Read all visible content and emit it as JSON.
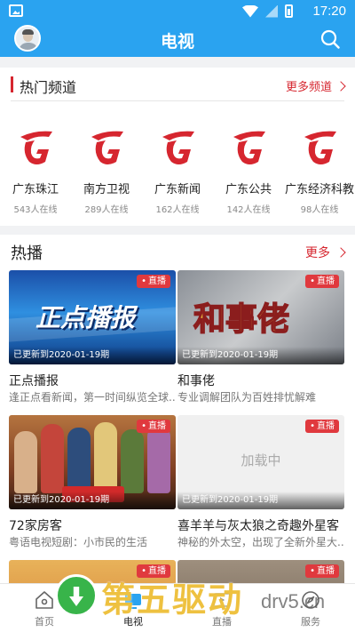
{
  "status_bar": {
    "time": "17:20",
    "battery_level": 0.5
  },
  "header": {
    "title": "电视"
  },
  "hot_channels": {
    "title": "热门频道",
    "more_label": "更多频道",
    "channels": [
      {
        "name": "广东珠江",
        "viewers": "543人在线"
      },
      {
        "name": "南方卫视",
        "viewers": "289人在线"
      },
      {
        "name": "广东新闻",
        "viewers": "162人在线"
      },
      {
        "name": "广东公共",
        "viewers": "142人在线"
      },
      {
        "name": "广东经济科教",
        "viewers": "98人在线"
      }
    ]
  },
  "hot_shows": {
    "title": "热播",
    "more_label": "更多",
    "items": [
      {
        "badge": "直播",
        "updated": "已更新到2020-01-19期",
        "title": "正点播报",
        "desc": "逢正点看新闻，第一时间纵览全球...",
        "thumb_text": "正点播报"
      },
      {
        "badge": "直播",
        "updated": "已更新到2020-01-19期",
        "title": "和事佬",
        "desc": "专业调解团队为百姓排忧解难",
        "thumb_text": "和事佬"
      },
      {
        "badge": "直播",
        "updated": "已更新到2020-01-19期",
        "title": "72家房客",
        "desc": "粤语电视短剧：小市民的生活",
        "thumb_text": ""
      },
      {
        "badge": "直播",
        "updated": "已更新到2020-01-19期",
        "title": "喜羊羊与灰太狼之奇趣外星客",
        "desc": "神秘的外太空，出现了全新外星大...",
        "thumb_text": "加载中"
      },
      {
        "badge": "直播",
        "updated": "",
        "title": "",
        "desc": "",
        "thumb_text": ""
      },
      {
        "badge": "直播",
        "updated": "",
        "title": "",
        "desc": "",
        "thumb_text": ""
      }
    ]
  },
  "tab_bar": {
    "tabs": [
      {
        "label": "首页",
        "icon": "home-icon"
      },
      {
        "label": "电视",
        "icon": "tv-icon"
      },
      {
        "label": "直播",
        "icon": "live-icon"
      },
      {
        "label": "服务",
        "icon": "compass-icon"
      }
    ],
    "active": "电视"
  },
  "watermark": {
    "text": "第五驱动",
    "url": "drv5.cn"
  },
  "colors": {
    "brand_blue": "#2aa3f0",
    "accent_red": "#d6262f",
    "badge_red": "#e0393e"
  }
}
